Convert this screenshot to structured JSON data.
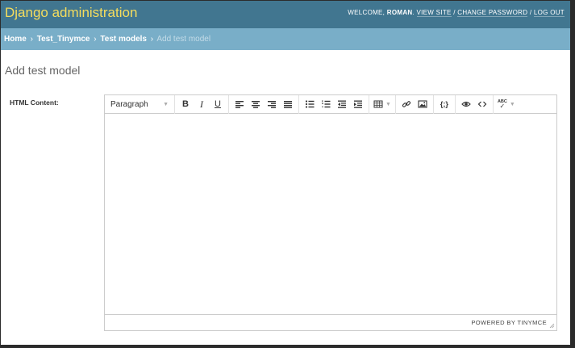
{
  "header": {
    "site_title": "Django administration",
    "welcome": "WELCOME,",
    "username": "ROMAN",
    "view_site": "VIEW SITE",
    "change_password": "CHANGE PASSWORD",
    "log_out": "LOG OUT",
    "separator": "/"
  },
  "breadcrumbs": {
    "home": "Home",
    "app": "Test_Tinymce",
    "model": "Test models",
    "current": "Add test model",
    "separator": "›"
  },
  "page": {
    "title": "Add test model"
  },
  "form": {
    "field_label": "HTML Content:"
  },
  "editor": {
    "format_select": "Paragraph",
    "bold": "B",
    "italic": "I",
    "underline": "U",
    "code_sample": "{;}",
    "spellcheck": "ABC",
    "powered_by": "POWERED BY TINYMCE"
  },
  "colors": {
    "header_bg": "#417690",
    "header_title": "#f5dd5d",
    "breadcrumb_bg": "#79aec8"
  }
}
